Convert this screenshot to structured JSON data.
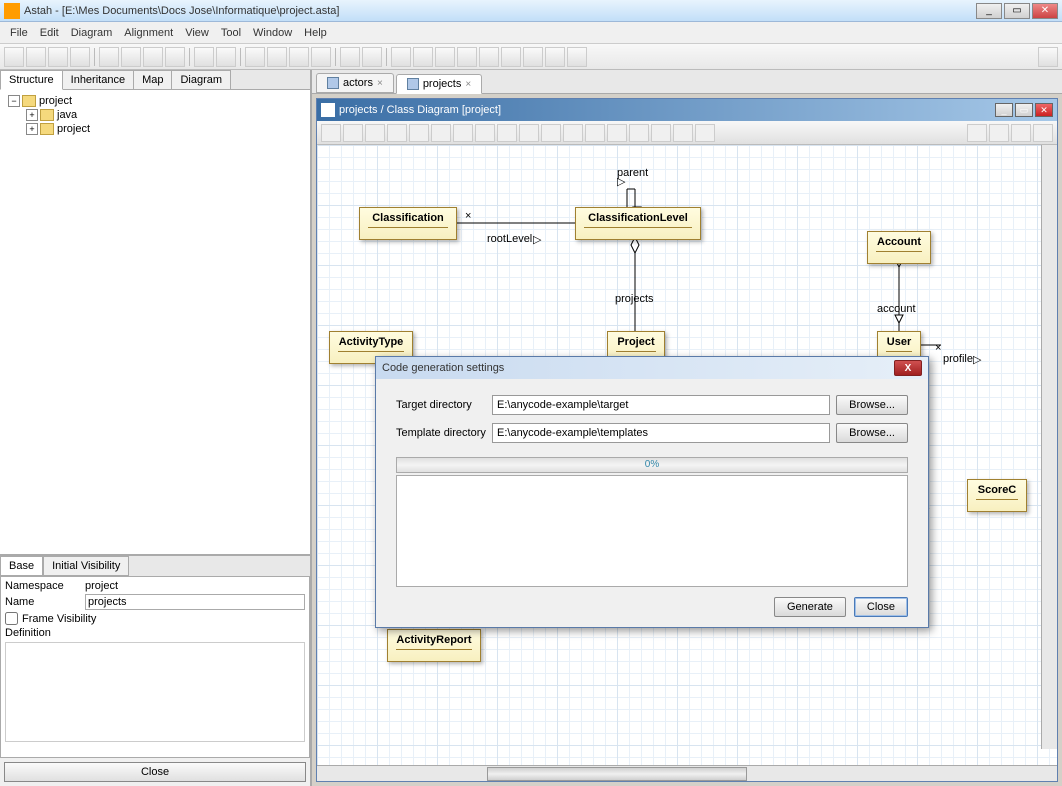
{
  "window": {
    "title": "Astah - [E:\\Mes Documents\\Docs Jose\\Informatique\\project.asta]"
  },
  "menu": [
    "File",
    "Edit",
    "Diagram",
    "Alignment",
    "View",
    "Tool",
    "Window",
    "Help"
  ],
  "left_tabs": [
    "Structure",
    "Inheritance",
    "Map",
    "Diagram"
  ],
  "tree": {
    "root": "project",
    "children": [
      "java",
      "project"
    ]
  },
  "prop_tabs": [
    "Base",
    "Initial Visibility"
  ],
  "props": {
    "namespace_label": "Namespace",
    "namespace_value": "project",
    "name_label": "Name",
    "name_value": "projects",
    "frame_visibility": "Frame Visibility",
    "definition_label": "Definition",
    "close": "Close"
  },
  "doc_tabs": [
    {
      "label": "actors",
      "active": false
    },
    {
      "label": "projects",
      "active": true
    }
  ],
  "diagram_title": "projects / Class Diagram [project]",
  "classes": {
    "classification": "Classification",
    "classification_level": "ClassificationLevel",
    "account": "Account",
    "activity_type": "ActivityType",
    "project": "Project",
    "user": "User",
    "activity_report": "ActivityReport",
    "scorec": "ScoreC"
  },
  "labels": {
    "parent": "parent",
    "rootlevel": "rootLevel",
    "projects": "projects",
    "account": "account",
    "profile": "profile"
  },
  "dialog": {
    "title": "Code generation settings",
    "target_label": "Target directory",
    "target_value": "E:\\anycode-example\\target",
    "template_label": "Template directory",
    "template_value": "E:\\anycode-example\\templates",
    "browse": "Browse...",
    "progress": "0%",
    "generate": "Generate",
    "close": "Close"
  }
}
